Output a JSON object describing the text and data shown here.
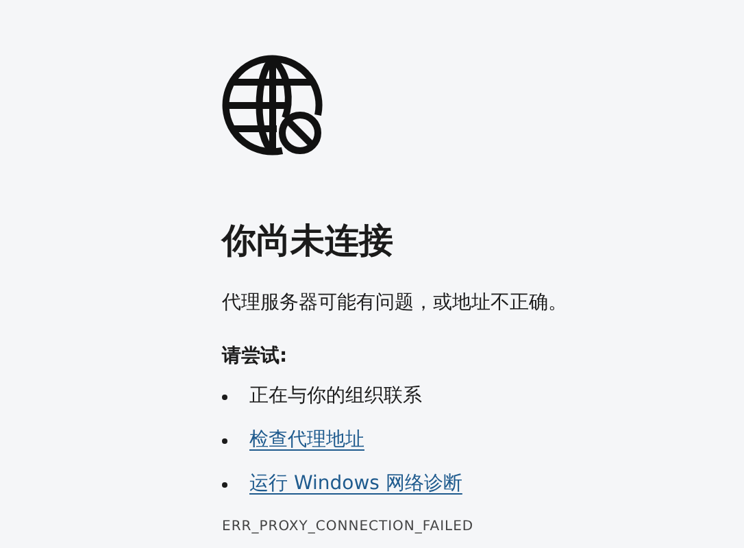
{
  "title": "你尚未连接",
  "message": "代理服务器可能有问题，或地址不正确。",
  "try_heading": "请尝试:",
  "suggestions": [
    {
      "kind": "text",
      "label": "正在与你的组织联系"
    },
    {
      "kind": "link",
      "label": "检查代理地址"
    },
    {
      "kind": "link",
      "label": "运行 Windows 网络诊断"
    }
  ],
  "error_code": "ERR_PROXY_CONNECTION_FAILED"
}
